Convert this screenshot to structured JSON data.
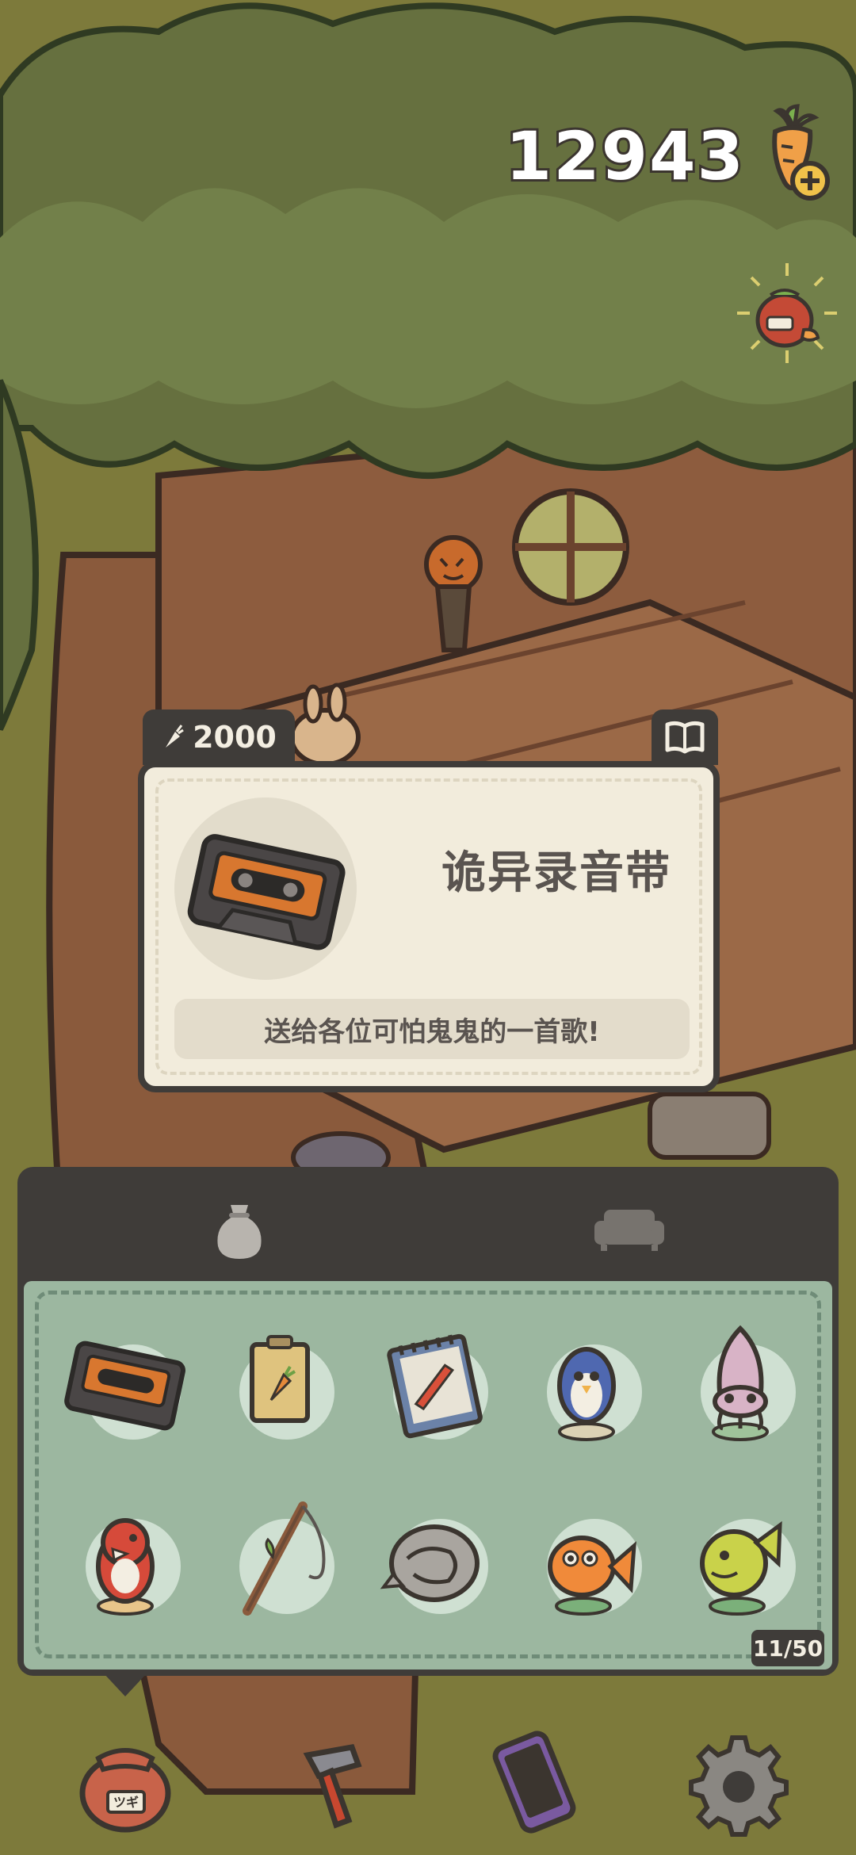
{
  "hud": {
    "carrot_count": "12943",
    "carrot_icon": "carrot-plus-icon",
    "gift_icon": "carrot-gift-bag-icon"
  },
  "item_card": {
    "price": "2000",
    "price_icon": "carrot-small-icon",
    "book_icon": "open-book-icon",
    "name": "诡异录音带",
    "description": "送给各位可怕鬼鬼的一首歌!",
    "image_icon": "cassette-tape-icon"
  },
  "inventory": {
    "tabs": [
      {
        "icon": "sack-icon",
        "active": true
      },
      {
        "icon": "sofa-icon",
        "active": false
      }
    ],
    "items": [
      {
        "icon": "cassette-tape-icon"
      },
      {
        "icon": "carrot-seed-packet-icon"
      },
      {
        "icon": "notepad-icon"
      },
      {
        "icon": "blue-penguin-figure-icon"
      },
      {
        "icon": "squid-figure-icon"
      },
      {
        "icon": "red-parrot-figure-icon"
      },
      {
        "icon": "fishing-rod-icon"
      },
      {
        "icon": "stone-helmet-icon"
      },
      {
        "icon": "goldfish-figure-icon"
      },
      {
        "icon": "green-fish-figure-icon"
      }
    ],
    "count": "11/50"
  },
  "nav": [
    {
      "icon": "bag-icon",
      "label_on_bag": "ツギ"
    },
    {
      "icon": "hammer-icon"
    },
    {
      "icon": "phone-icon"
    },
    {
      "icon": "gear-icon"
    }
  ],
  "colors": {
    "panel_dark": "#3f3c39",
    "card_bg": "#f2ecdc",
    "grid_bg": "#9cb7a0",
    "grass": "#7c7a3a"
  }
}
